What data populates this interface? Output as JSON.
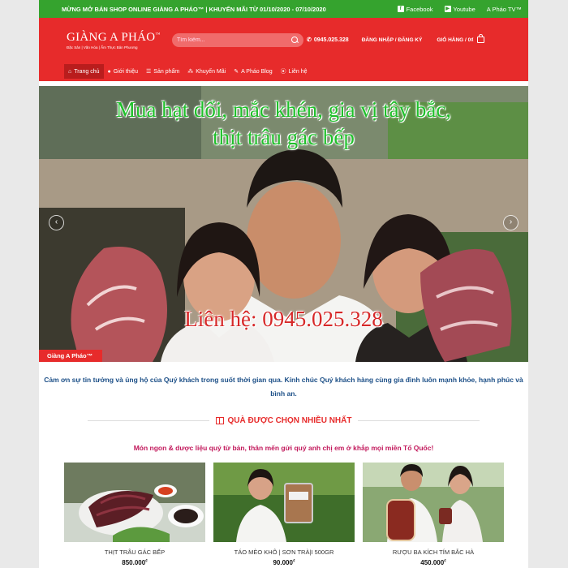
{
  "topbar": {
    "promo": "MỪNG MỞ BÁN SHOP ONLINE GIÀNG A PHÁO™ | KHUYẾN MÃI TỪ 01/10/2020 - 07/10/2020",
    "links": [
      {
        "label": "Facebook",
        "icon": "facebook-icon"
      },
      {
        "label": "Youtube",
        "icon": "youtube-icon"
      },
      {
        "label": "A Pháo TV™",
        "icon": ""
      }
    ]
  },
  "header": {
    "logo_text": "GIÀNG A PHÁO",
    "logo_tm": "™",
    "logo_tagline": "Đặc Sản | Văn Hóa | Ẩm Thực Bản Phương",
    "search_placeholder": "Tìm kiếm...",
    "phone": "0945.025.328",
    "login": "ĐĂNG NHẬP / ĐĂNG KÝ",
    "cart": "GIỎ HÀNG / 0₫"
  },
  "nav": {
    "items": [
      {
        "label": "Trang chủ",
        "icon": "home-icon",
        "glyph": "⌂"
      },
      {
        "label": "Giới thiệu",
        "icon": "info-icon",
        "glyph": "●"
      },
      {
        "label": "Sản phẩm",
        "icon": "list-icon",
        "glyph": "☰"
      },
      {
        "label": "Khuyến Mãi",
        "icon": "sitemap-icon",
        "glyph": "⁂"
      },
      {
        "label": "A Pháo Blog",
        "icon": "edit-icon",
        "glyph": "✎"
      },
      {
        "label": "Liên hệ",
        "icon": "location-icon",
        "glyph": "⦿"
      }
    ]
  },
  "hero": {
    "headline_line1": "Mua hạt dổi,  mắc khén, gia vị tây bắc,",
    "headline_line2": "thịt trâu gác bếp",
    "contact": "Liên hệ: 0945.025.328",
    "caption": "Giàng A Pháo™",
    "prev": "‹",
    "next": "›"
  },
  "thanks": "Cảm ơn sự tin tưởng và ủng hộ của Quý khách trong suốt thời gian qua. Kính chúc Quý khách hàng cùng gia đình luôn mạnh khỏe, hạnh phúc và bình an.",
  "section": {
    "title": "QUÀ ĐƯỢC CHỌN NHIỀU NHẤT",
    "subtitle": "Món ngon & dược liệu quý từ bản, thân mến gửi quý anh chị em ở khắp mọi miền Tổ Quốc!"
  },
  "products": [
    {
      "name": "THỊT TRÂU GÁC BẾP",
      "price": "850.000",
      "currency": "₫"
    },
    {
      "name": "TÁO MÈO KHÔ | SƠN TRÀ|I 500GR",
      "price": "90.000",
      "currency": "₫"
    },
    {
      "name": "RƯỢU BA KÍCH TÍM BẮC HÀ",
      "price": "450.000",
      "currency": "₫"
    }
  ],
  "colors": {
    "topbar": "#35a32e",
    "header": "#e72b2b",
    "headline": "#1fbf2a",
    "contact": "#d62828",
    "thanks": "#1c4f87",
    "subtitle": "#c2185b"
  }
}
